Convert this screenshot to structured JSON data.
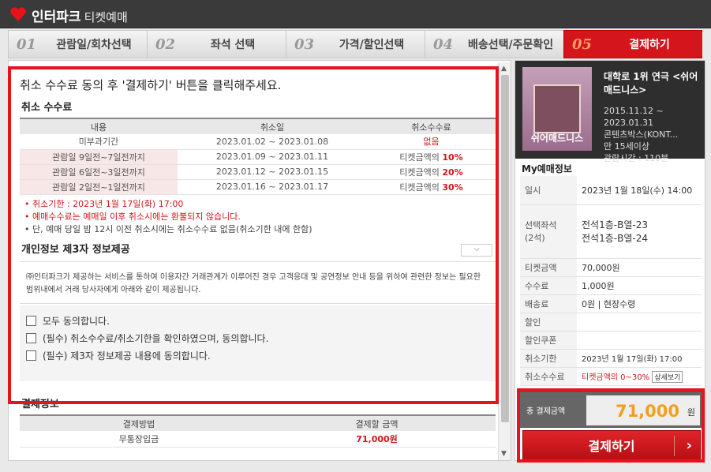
{
  "header": {
    "brand": "인터파크",
    "service": "티켓예매"
  },
  "steps": [
    {
      "num": "01",
      "label": "관람일/회차선택"
    },
    {
      "num": "02",
      "label": "좌석 선택"
    },
    {
      "num": "03",
      "label": "가격/할인선택"
    },
    {
      "num": "04",
      "label": "배송선택/주문확인"
    },
    {
      "num": "05",
      "label": "결제하기"
    }
  ],
  "main": {
    "headline": "취소 수수료 동의 후 '결제하기' 버튼을 클릭해주세요.",
    "cancel_title": "취소 수수료",
    "fee_headers": [
      "내용",
      "취소일",
      "취소수수료"
    ],
    "fee_rows": [
      {
        "content": "미부과기간",
        "date": "2023.01.02 ~ 2023.01.08",
        "fee": "없음",
        "fee_pct": ""
      },
      {
        "content": "관람일 9일전~7일전까지",
        "date": "2023.01.09 ~ 2023.01.11",
        "fee": "티켓금액의 ",
        "fee_pct": "10%"
      },
      {
        "content": "관람일 6일전~3일전까지",
        "date": "2023.01.12 ~ 2023.01.15",
        "fee": "티켓금액의 ",
        "fee_pct": "20%"
      },
      {
        "content": "관람일 2일전~1일전까지",
        "date": "2023.01.16 ~ 2023.01.17",
        "fee": "티켓금액의 ",
        "fee_pct": "30%"
      }
    ],
    "notes": [
      "취소기한 : 2023년 1월 17일(화) 17:00",
      "예매수수료는 예매일 이후 취소시에는 환불되지 않습니다.",
      "단, 예매 당일 밤 12시 이전 취소시에는 취소수수료 없음(취소기한 내에 한함)"
    ],
    "privacy_title": "개인정보 제3자 정보제공",
    "privacy_text": "㈜인터파크가 제공하는 서비스를 통하여 이용자간 거래관계가 이루어진 경우 고객응대 및 공연정보 안내 등을 위하여 관련한 정보는 필요한 범위내에서 거래 당사자에게 아래와 같이 제공됩니다.",
    "agree": [
      "모두 동의합니다.",
      "(필수) 취소수수료/취소기한을 확인하였으며, 동의합니다.",
      "(필수) 제3자 정보제공 내용에 동의합니다."
    ],
    "payinfo_title": "결제정보",
    "pay_headers": [
      "결제방법",
      "결제할 금액"
    ],
    "pay_row": {
      "method": "무통장입금",
      "amount": "71,000원"
    }
  },
  "side": {
    "poster_title": "쉬어매드니스",
    "show_title": "대학로 1위 연극 <쉬어매드니스>",
    "show_info": [
      "2015.11.12 ~",
      "2023.01.31",
      "콘텐츠박스(KONT...",
      "만 15세이상",
      "관람시간 : 110분"
    ],
    "my_title": "My예매정보",
    "rows": [
      {
        "k": "일시",
        "v": "2023년 1월 18일(수) 14:00"
      },
      {
        "k": "선택좌석\n(2석)",
        "v": "전석1층-B열-23\n전석1층-B열-24"
      },
      {
        "k": "티켓금액",
        "v": "70,000원"
      },
      {
        "k": "수수료",
        "v": "1,000원"
      },
      {
        "k": "배송료",
        "v": "0원 | 현장수령"
      },
      {
        "k": "할인",
        "v": ""
      },
      {
        "k": "할인쿠폰",
        "v": ""
      },
      {
        "k": "취소기한",
        "v": "2023년 1월 17일(화) 17:00"
      },
      {
        "k": "취소수수료",
        "v": "티켓금액의 0~30%",
        "btn": "상세보기"
      }
    ],
    "total_label": "총 결제금액",
    "total_value": "71,000",
    "total_unit": "원",
    "pay_button": "결제하기"
  }
}
